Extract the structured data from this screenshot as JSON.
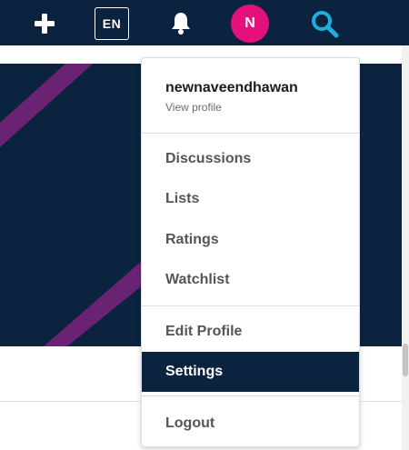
{
  "theme": {
    "navy": "#0c2340",
    "pink": "#e5117a",
    "accent": "#1eaedb",
    "stripe": "#6a2373"
  },
  "topbar": {
    "add_icon": "plus-icon",
    "language_label": "EN",
    "notification_icon": "bell-icon",
    "avatar_initial": "N",
    "search_icon": "search-icon"
  },
  "profile": {
    "username": "newnaveendhawan",
    "view_profile_label": "View profile"
  },
  "menu": {
    "discussions": "Discussions",
    "lists": "Lists",
    "ratings": "Ratings",
    "watchlist": "Watchlist",
    "edit_profile": "Edit Profile",
    "settings": "Settings",
    "logout": "Logout",
    "active_item": "Settings"
  }
}
